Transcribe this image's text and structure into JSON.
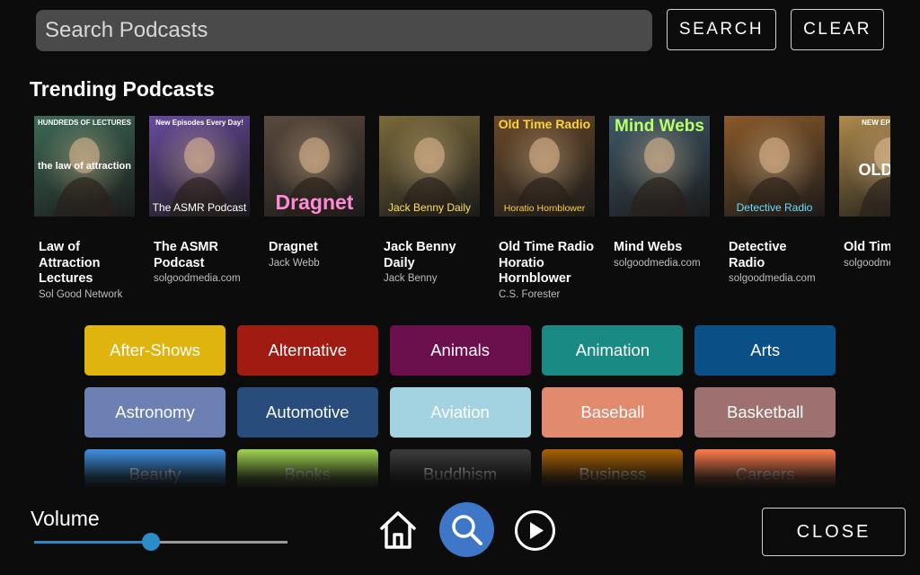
{
  "search": {
    "placeholder": "Search Podcasts",
    "search_label": "SEARCH",
    "clear_label": "CLEAR"
  },
  "trending": {
    "title": "Trending Podcasts",
    "items": [
      {
        "title": "Law of Attraction Lectures",
        "author": "Sol Good Network",
        "cover_top": "HUNDREDS OF LECTURES",
        "cover_main": "the law of attraction",
        "cover_bottom": "",
        "cover_color": "#3d6b58",
        "cover_icon": "raised-hand-icon"
      },
      {
        "title": "The ASMR Podcast",
        "author": "solgoodmedia.com",
        "cover_top": "New Episodes Every Day!",
        "cover_main": "",
        "cover_bottom": "The ASMR Podcast",
        "cover_color": "#6a4c9e",
        "cover_icon": "headphones-face-icon"
      },
      {
        "title": "Dragnet",
        "author": "Jack Webb",
        "cover_top": "",
        "cover_main": "",
        "cover_bottom": "Dragnet",
        "cover_color": "#5b4a3e",
        "cover_icon": "detective-portrait-icon"
      },
      {
        "title": "Jack Benny Daily",
        "author": "Jack Benny",
        "cover_top": "",
        "cover_main": "",
        "cover_bottom": "Jack Benny Daily",
        "cover_color": "#7a6a3a",
        "cover_icon": "microphone-man-icon"
      },
      {
        "title": "Old Time Radio Horatio Hornblower",
        "author": "C.S. Forester",
        "cover_top": "Old Time Radio",
        "cover_main": "",
        "cover_bottom": "Horatio Hornblower",
        "cover_color": "#6a4a2a",
        "cover_icon": "ship-captain-icon"
      },
      {
        "title": "Mind Webs",
        "author": "solgoodmedia.com",
        "cover_top": "Mind Webs",
        "cover_main": "",
        "cover_bottom": "",
        "cover_color": "#3f5a6a",
        "cover_icon": "woman-face-icon"
      },
      {
        "title": "Detective Radio",
        "author": "solgoodmedia.com",
        "cover_top": "",
        "cover_main": "",
        "cover_bottom": "Detective Radio",
        "cover_color": "#8a5a2a",
        "cover_icon": "detectives-icon"
      },
      {
        "title": "Old Time Radio",
        "author": "solgoodmedia.com",
        "cover_top": "NEW EPISODES",
        "cover_main": "OLD RA",
        "cover_bottom": "",
        "cover_color": "#b08a4a",
        "cover_icon": "radio-icon"
      }
    ]
  },
  "genres": [
    {
      "label": "After-Shows",
      "color": "#e0b40f"
    },
    {
      "label": "Alternative",
      "color": "#a01b12"
    },
    {
      "label": "Animals",
      "color": "#6b0f4d"
    },
    {
      "label": "Animation",
      "color": "#1a8a85"
    },
    {
      "label": "Arts",
      "color": "#0a4f85"
    },
    {
      "label": "Astronomy",
      "color": "#6d80b4"
    },
    {
      "label": "Automotive",
      "color": "#284c7c"
    },
    {
      "label": "Aviation",
      "color": "#a3d3e0"
    },
    {
      "label": "Baseball",
      "color": "#e18a6e"
    },
    {
      "label": "Basketball",
      "color": "#9e7070"
    },
    {
      "label": "Beauty",
      "color": "#3d8ad8"
    },
    {
      "label": "Books",
      "color": "#9acd4e"
    },
    {
      "label": "Buddhism",
      "color": "#3a3a3a"
    },
    {
      "label": "Business",
      "color": "#a35f06"
    },
    {
      "label": "Careers",
      "color": "#f2784a"
    }
  ],
  "footer": {
    "volume_label": "Volume",
    "volume_level": 0.46,
    "home_icon": "home-icon",
    "search_icon": "search-icon",
    "play_icon": "play-icon",
    "close_label": "CLOSE"
  }
}
